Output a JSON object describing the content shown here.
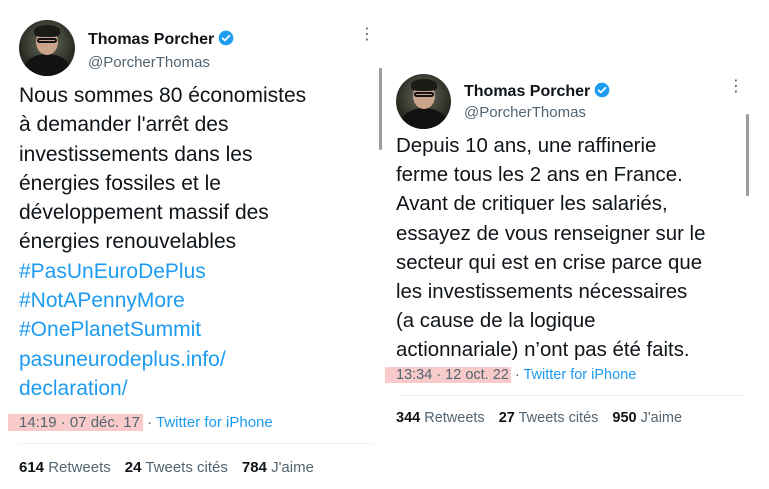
{
  "tweet_left": {
    "name": "Thomas Porcher",
    "handle": "@PorcherThomas",
    "more_icon": "more-vertical-icon",
    "text_lines": [
      "Nous sommes 80 économistes",
      "à demander l'arrêt des",
      "investissements dans les",
      "énergies fossiles et le",
      "développement massif des",
      "énergies renouvelables"
    ],
    "hashtags": [
      "#PasUnEuroDePlus",
      "#NotAPennyMore",
      "#OnePlanetSummit"
    ],
    "link_lines": [
      "pasuneurodeplus.info/",
      "declaration/"
    ],
    "timestamp": "14:19 · 07 déc. 17",
    "source": "Twitter for iPhone",
    "retweets": "614",
    "retweets_label": "Retweets",
    "quotes": "24",
    "quotes_label": "Tweets cités",
    "likes": "784",
    "likes_label": "J'aime"
  },
  "tweet_right": {
    "name": "Thomas Porcher",
    "handle": "@PorcherThomas",
    "more_icon": "more-vertical-icon",
    "text_lines": [
      "Depuis 10 ans, une raffinerie",
      "ferme tous les 2 ans en France.",
      "Avant de critiquer les salariés,",
      "essayez de vous renseigner sur le",
      "secteur qui est en crise parce que",
      "les investissements nécessaires",
      "(a cause de la logique",
      "actionnariale) n’ont pas été faits."
    ],
    "timestamp": "13:34 · 12 oct. 22",
    "source": "Twitter for iPhone",
    "retweets": "344",
    "retweets_label": "Retweets",
    "quotes": "27",
    "quotes_label": "Tweets cités",
    "likes": "950",
    "likes_label": "J'aime"
  },
  "colors": {
    "link": "#1d9bf0",
    "highlight": "#f8caca",
    "secondary": "#536471",
    "verified": "#1d9bf0"
  }
}
